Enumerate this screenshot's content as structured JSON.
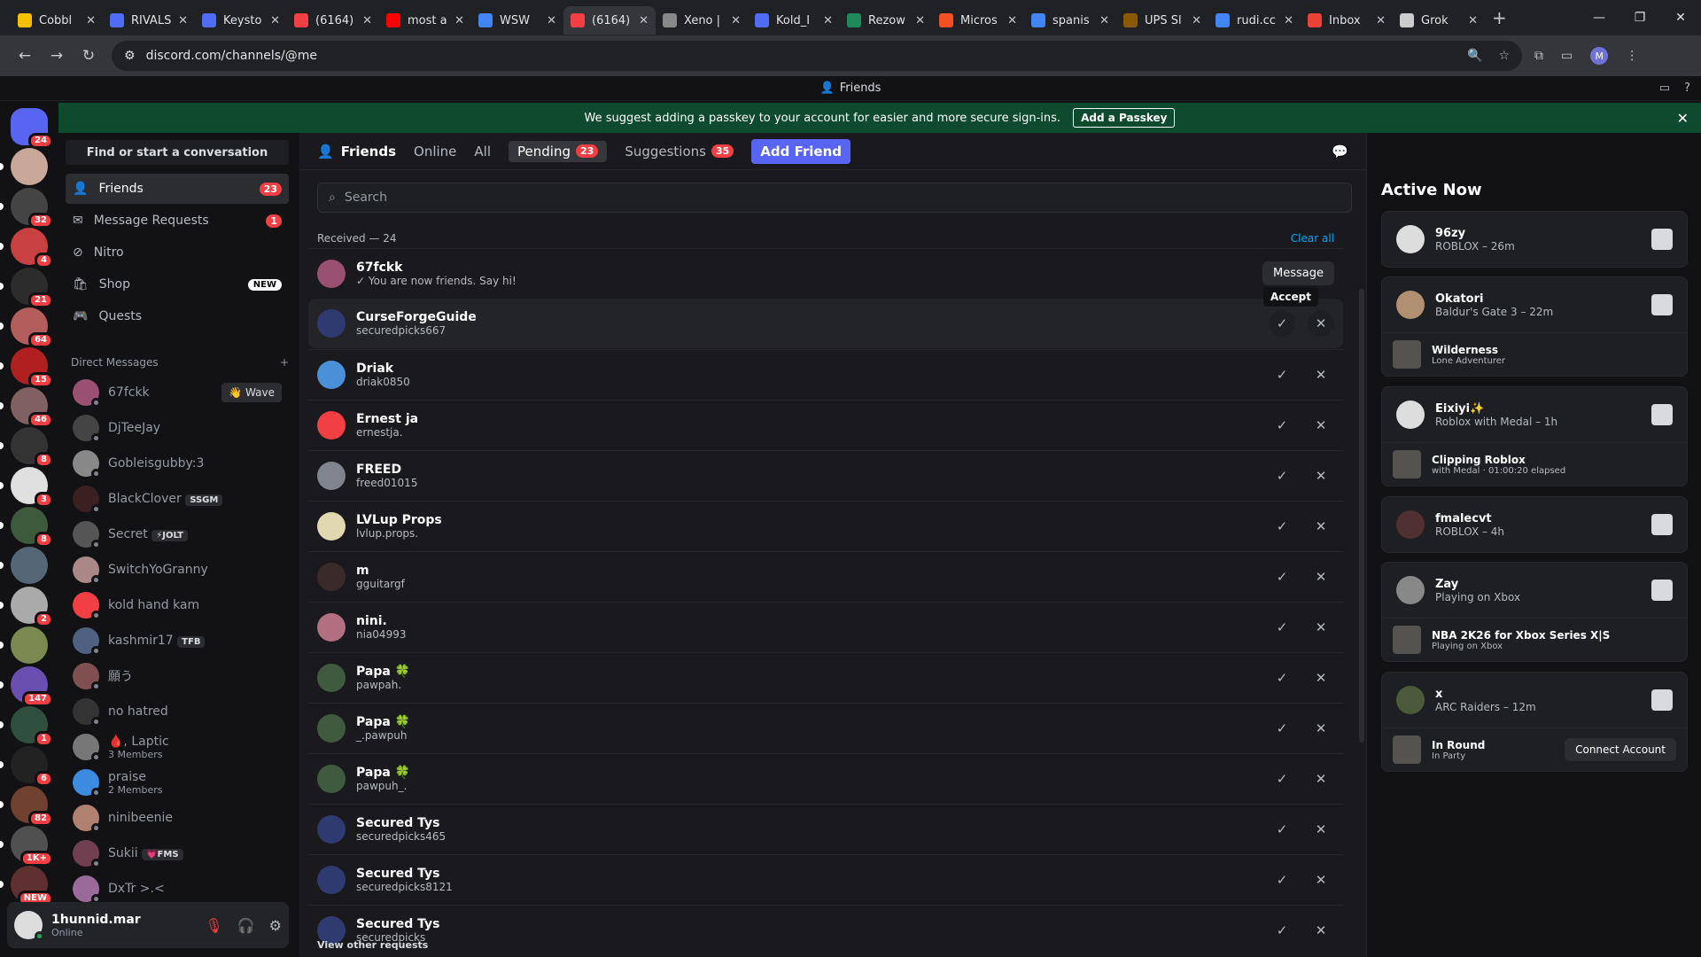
{
  "browser": {
    "tabs": [
      {
        "title": "Cobbl",
        "color": "#f5c000"
      },
      {
        "title": "RIVALS",
        "color": "#4f6cf7"
      },
      {
        "title": "Keysto",
        "color": "#4f6cf7"
      },
      {
        "title": "(6164)",
        "color": "#f23f43"
      },
      {
        "title": "most a",
        "color": "#ff0000"
      },
      {
        "title": "WSW",
        "color": "#4285f4"
      },
      {
        "title": "(6164)",
        "color": "#f23f43"
      },
      {
        "title": "Xeno |",
        "color": "#888888"
      },
      {
        "title": "Kold_I",
        "color": "#4f6cf7"
      },
      {
        "title": "Rezow",
        "color": "#1e8a5a"
      },
      {
        "title": "Micros",
        "color": "#f25022"
      },
      {
        "title": "spanis",
        "color": "#4285f4"
      },
      {
        "title": "UPS Sl",
        "color": "#8b5a00"
      },
      {
        "title": "rudi.cc",
        "color": "#4285f4"
      },
      {
        "title": "Inbox",
        "color": "#ea4335"
      },
      {
        "title": "Grok",
        "color": "#cccccc"
      }
    ],
    "url": "discord.com/channels/@me",
    "profile_initial": "M"
  },
  "title_bar": {
    "title": "Friends"
  },
  "banner": {
    "text": "We suggest adding a passkey to your account for easier and more secure sign-ins.",
    "button": "Add a Passkey"
  },
  "guilds": [
    {
      "badge": "24",
      "color": "#5865f2"
    },
    {
      "badge": "",
      "color": "#c9a79a"
    },
    {
      "badge": "32",
      "color": "#444444"
    },
    {
      "badge": "4",
      "color": "#c94040"
    },
    {
      "badge": "21",
      "color": "#2c2c2c"
    },
    {
      "badge": "64",
      "color": "#b45d5d"
    },
    {
      "badge": "15",
      "color": "#b02020"
    },
    {
      "badge": "46",
      "color": "#806060"
    },
    {
      "badge": "8",
      "color": "#333333"
    },
    {
      "badge": "3",
      "color": "#e0e0e0"
    },
    {
      "badge": "8",
      "color": "#3d5a3d"
    },
    {
      "badge": "",
      "color": "#556677"
    },
    {
      "badge": "2",
      "color": "#aaaaaa"
    },
    {
      "badge": "",
      "color": "#7a8a50"
    },
    {
      "badge": "147",
      "color": "#6a4fb0"
    },
    {
      "badge": "1",
      "color": "#2f4f3f"
    },
    {
      "badge": "6",
      "color": "#222222"
    },
    {
      "badge": "82",
      "color": "#704030"
    },
    {
      "badge": "1K+",
      "color": "#505050"
    },
    {
      "badge": "NEW",
      "color": "#603030"
    }
  ],
  "sidebar": {
    "find": "Find or start a conversation",
    "nav": [
      {
        "label": "Friends",
        "badge": "23"
      },
      {
        "label": "Message Requests",
        "badge": "1"
      },
      {
        "label": "Nitro",
        "badge": ""
      },
      {
        "label": "Shop",
        "badge": "NEW"
      },
      {
        "label": "Quests",
        "badge": ""
      }
    ],
    "dm_header": "Direct Messages",
    "dms": [
      {
        "name": "67fckk",
        "tag": "",
        "sub": "",
        "extra": "👋 Wave",
        "color": "#9a5070"
      },
      {
        "name": "DjTeeJay",
        "tag": "",
        "sub": "",
        "extra": "",
        "color": "#444444"
      },
      {
        "name": "Gobleisgubby:3",
        "tag": "",
        "sub": "",
        "extra": "",
        "color": "#888888"
      },
      {
        "name": "BlackClover",
        "tag": "SSGM",
        "sub": "",
        "extra": "",
        "color": "#3a2020"
      },
      {
        "name": "Secret",
        "tag": "⚡JOLT",
        "sub": "",
        "extra": "",
        "color": "#555555"
      },
      {
        "name": "SwitchYoGranny",
        "tag": "",
        "sub": "",
        "extra": "",
        "color": "#aa8888"
      },
      {
        "name": "kold hand kam",
        "tag": "",
        "sub": "",
        "extra": "",
        "color": "#f23f43"
      },
      {
        "name": "kashmir17",
        "tag": "TFB",
        "sub": "",
        "extra": "",
        "color": "#506080"
      },
      {
        "name": "願う",
        "tag": "",
        "sub": "",
        "extra": "",
        "color": "#805050"
      },
      {
        "name": "no hatred",
        "tag": "",
        "sub": "",
        "extra": "",
        "color": "#333333"
      },
      {
        "name": "🩸, Laptic",
        "tag": "",
        "sub": "3 Members",
        "extra": "",
        "color": "#777777"
      },
      {
        "name": "praise",
        "tag": "",
        "sub": "2 Members",
        "extra": "",
        "color": "#3b8be0"
      },
      {
        "name": "ninibeenie",
        "tag": "",
        "sub": "",
        "extra": "",
        "color": "#b08070"
      },
      {
        "name": "Sukii",
        "tag": "💗FMS",
        "sub": "",
        "extra": "",
        "color": "#704050"
      },
      {
        "name": "DxTr >.<",
        "tag": "",
        "sub": "",
        "extra": "",
        "color": "#9a6a9a"
      }
    ]
  },
  "user": {
    "name": "1hunnid.mar",
    "status": "Online"
  },
  "topnav": {
    "friends": "Friends",
    "online": "Online",
    "all": "All",
    "pending": "Pending",
    "pending_count": "23",
    "suggestions": "Suggestions",
    "suggestions_count": "35",
    "add_friend": "Add Friend"
  },
  "search_placeholder": "Search",
  "received": "Received — 24",
  "clear_all": "Clear all",
  "tooltip": "Accept",
  "message_button": "Message",
  "requests": [
    {
      "name": "67fckk",
      "user": "✓ You are now friends. Say hi!",
      "color": "#9a5070"
    },
    {
      "name": "CurseForgeGuide",
      "user": "securedpicks667",
      "color": "#2e3a70"
    },
    {
      "name": "Driak",
      "user": "driak0850",
      "color": "#4a90d9"
    },
    {
      "name": "Ernest ja",
      "user": "ernestja.",
      "color": "#f23f43"
    },
    {
      "name": "FREED",
      "user": "freed01015",
      "color": "#80848e"
    },
    {
      "name": "LVLup Props",
      "user": "lvlup.props.",
      "color": "#e0d8b0"
    },
    {
      "name": "m",
      "user": "gguitargf",
      "color": "#3a2a2a"
    },
    {
      "name": "nini.",
      "user": "nia04993",
      "color": "#b07080"
    },
    {
      "name": "Papa 🍀",
      "user": "pawpah.",
      "color": "#405a40"
    },
    {
      "name": "Papa 🍀",
      "user": "_.pawpuh",
      "color": "#405a40"
    },
    {
      "name": "Papa 🍀",
      "user": "pawpuh_.",
      "color": "#405a40"
    },
    {
      "name": "Secured Tys",
      "user": "securedpicks465",
      "color": "#2e3a70"
    },
    {
      "name": "Secured Tys",
      "user": "securedpicks8121",
      "color": "#2e3a70"
    },
    {
      "name": "Secured Tys",
      "user": "securedpicks",
      "color": "#2e3a70"
    }
  ],
  "view_other": "View other requests",
  "active_now": {
    "title": "Active Now",
    "cards": [
      {
        "name": "96zy",
        "status": "ROBLOX – 26m",
        "activity": null,
        "color": "#dddddd"
      },
      {
        "name": "Okatori",
        "status": "Baldur's Gate 3 – 22m",
        "activity": {
          "name": "Wilderness",
          "sub": "Lone Adventurer"
        },
        "color": "#b09070"
      },
      {
        "name": "Eixiyi✨",
        "status": "Roblox with Medal – 1h",
        "activity": {
          "name": "Clipping Roblox",
          "sub": "with Medal · 01:00:20 elapsed"
        },
        "color": "#dddddd"
      },
      {
        "name": "fmalecvt",
        "status": "ROBLOX – 4h",
        "activity": null,
        "color": "#503030"
      },
      {
        "name": "Zay",
        "status": "Playing on Xbox",
        "activity": {
          "name": "NBA 2K26 for Xbox Series X|S",
          "sub": "Playing on Xbox"
        },
        "color": "#888888"
      },
      {
        "name": "x",
        "status": "ARC Raiders – 12m",
        "activity": {
          "name": "In Round",
          "sub": "In Party"
        },
        "color": "#4a5a3a"
      }
    ],
    "connect": "Connect Account"
  }
}
